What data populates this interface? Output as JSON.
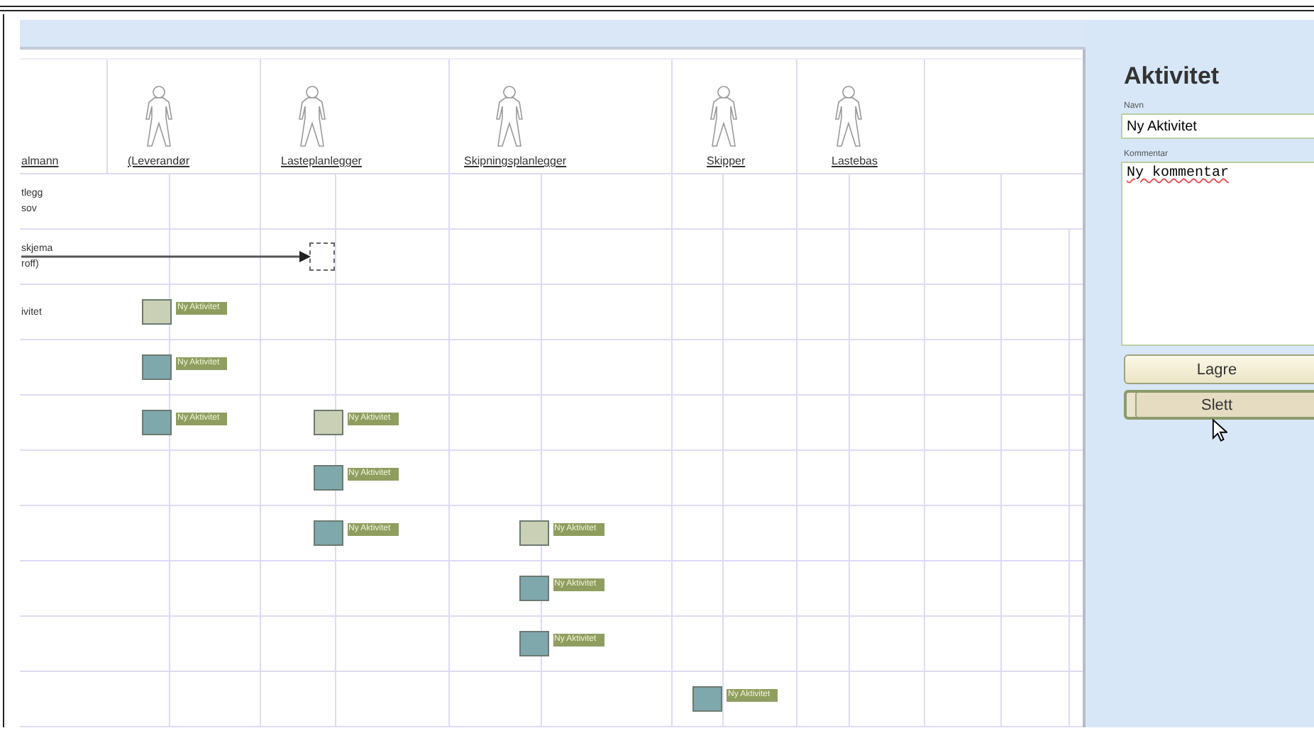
{
  "lanes": [
    {
      "kind": "label",
      "label": "almann"
    },
    {
      "kind": "actor",
      "label": "(Leverandør"
    },
    {
      "kind": "actor",
      "label": "Lasteplanlegger"
    },
    {
      "kind": "actor",
      "label": "Skipningsplanlegger"
    },
    {
      "kind": "actor",
      "label": "Skipper"
    },
    {
      "kind": "actor",
      "label": "Lastebas"
    }
  ],
  "rows": [
    {
      "label_lines": [
        "tlegg",
        "sov"
      ]
    },
    {
      "label_lines": [
        "skjema",
        "roff)"
      ],
      "arrow": true,
      "cells": [
        {
          "kind": "empty"
        },
        {
          "kind": "drop-target"
        }
      ]
    },
    {
      "label_lines": [
        "ivitet"
      ],
      "cells": [
        {
          "kind": "activity",
          "name": "Ny Aktivitet",
          "color": "#c9d0b5"
        }
      ]
    },
    {
      "cells": [
        {
          "kind": "activity",
          "name": "Ny Aktivitet",
          "color": "#7fa8ac"
        }
      ]
    },
    {
      "cells": [
        {
          "kind": "activity",
          "name": "Ny Aktivitet",
          "color": "#7fa8ac"
        },
        {
          "kind": "activity",
          "name": "Ny Aktivitet",
          "color": "#c9d0b5"
        }
      ]
    },
    {
      "cells": [
        {
          "kind": "empty"
        },
        {
          "kind": "activity",
          "name": "Ny Aktivitet",
          "color": "#7fa8ac"
        }
      ]
    },
    {
      "cells": [
        {
          "kind": "empty"
        },
        {
          "kind": "activity",
          "name": "Ny Aktivitet",
          "color": "#7fa8ac"
        },
        {
          "kind": "activity",
          "name": "Ny Aktivitet",
          "color": "#c9d0b5"
        }
      ]
    },
    {
      "cells": [
        {
          "kind": "empty"
        },
        {
          "kind": "empty"
        },
        {
          "kind": "activity",
          "name": "Ny Aktivitet",
          "color": "#7fa8ac"
        }
      ]
    },
    {
      "cells": [
        {
          "kind": "empty"
        },
        {
          "kind": "empty"
        },
        {
          "kind": "activity",
          "name": "Ny Aktivitet",
          "color": "#7fa8ac"
        }
      ]
    },
    {
      "cells": [
        {
          "kind": "empty"
        },
        {
          "kind": "empty"
        },
        {
          "kind": "empty"
        },
        {
          "kind": "activity",
          "name": "Ny Aktivitet",
          "color": "#7fa8ac"
        }
      ]
    }
  ],
  "panel": {
    "title": "Aktivitet",
    "fields": [
      {
        "kind": "input",
        "label": "Navn",
        "value": "Ny Aktivitet"
      },
      {
        "kind": "textarea",
        "label": "Kommentar",
        "value": "Ny kommentar"
      }
    ],
    "buttons": [
      {
        "label": "Lagre",
        "pressed": false
      },
      {
        "label": "Slett",
        "pressed": true
      }
    ]
  }
}
